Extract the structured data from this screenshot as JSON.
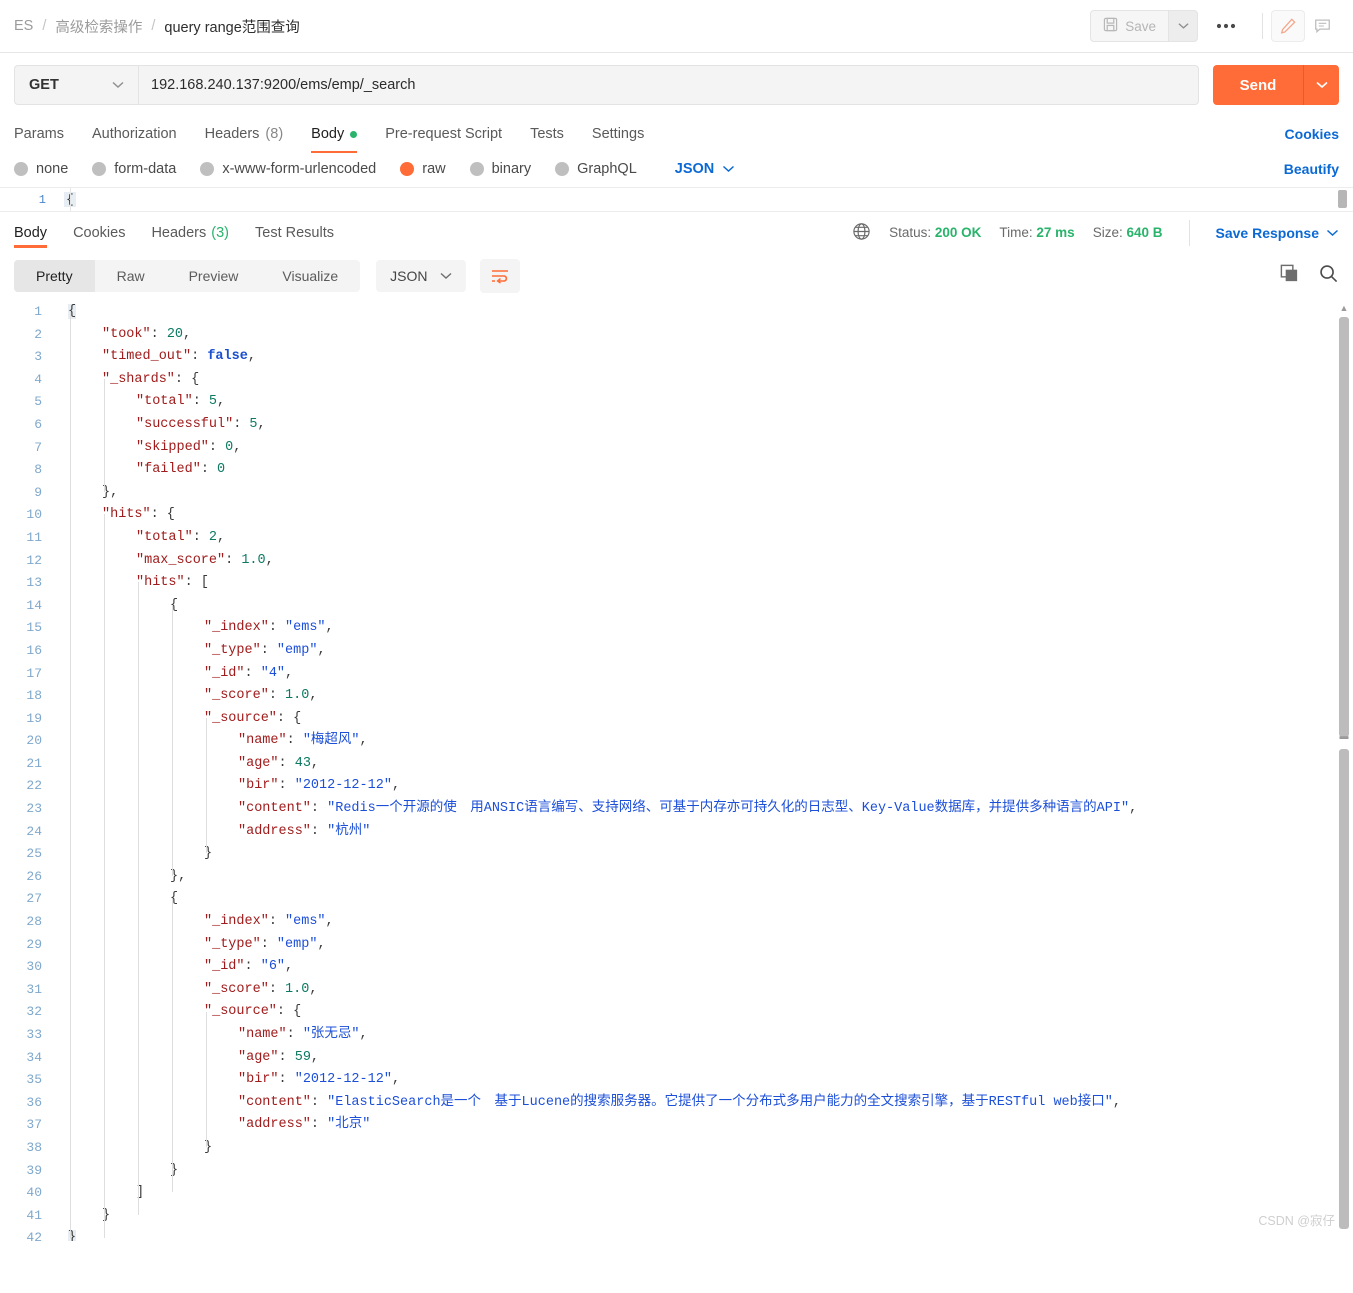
{
  "topbar": {
    "breadcrumb": [
      "ES",
      "高级检索操作",
      "query range范围查询"
    ],
    "separator": "/",
    "save_label": "Save",
    "more_label": "000",
    "caret": "∨"
  },
  "request": {
    "method": "GET",
    "method_caret": "∨",
    "url": "192.168.240.137:9200/ems/emp/_search",
    "send_label": "Send",
    "send_caret": "∨",
    "tabs": [
      {
        "label": "Params",
        "active": false
      },
      {
        "label": "Authorization",
        "active": false
      },
      {
        "label": "Headers",
        "count": "(8)",
        "active": false
      },
      {
        "label": "Body",
        "active": true,
        "dot": true
      },
      {
        "label": "Pre-request Script",
        "active": false
      },
      {
        "label": "Tests",
        "active": false
      },
      {
        "label": "Settings",
        "active": false
      }
    ],
    "cookies_label": "Cookies",
    "body_types": [
      {
        "label": "none",
        "selected": false
      },
      {
        "label": "form-data",
        "selected": false
      },
      {
        "label": "x-www-form-urlencoded",
        "selected": false
      },
      {
        "label": "raw",
        "selected": true
      },
      {
        "label": "binary",
        "selected": false
      },
      {
        "label": "GraphQL",
        "selected": false
      }
    ],
    "format": "JSON",
    "format_caret": "∨",
    "beautify_label": "Beautify",
    "editor_line_number": "1",
    "editor_text": "{"
  },
  "response": {
    "tabs": [
      {
        "label": "Body",
        "active": true
      },
      {
        "label": "Cookies",
        "active": false
      },
      {
        "label": "Headers",
        "count": "(3)",
        "active": false
      },
      {
        "label": "Test Results",
        "active": false
      }
    ],
    "status_label": "Status:",
    "status_value": "200 OK",
    "time_label": "Time:",
    "time_value": "27 ms",
    "size_label": "Size:",
    "size_value": "640 B",
    "save_response_label": "Save Response",
    "save_response_caret": "∨",
    "view_modes": [
      {
        "label": "Pretty",
        "active": true
      },
      {
        "label": "Raw",
        "active": false
      },
      {
        "label": "Preview",
        "active": false
      },
      {
        "label": "Visualize",
        "active": false
      }
    ],
    "format": "JSON",
    "format_caret": "∨",
    "lines": [
      {
        "no": "1",
        "indent": 0,
        "tokens": [
          {
            "t": "{",
            "c": "p",
            "hl": true
          }
        ]
      },
      {
        "no": "2",
        "indent": 1,
        "tokens": [
          {
            "t": "\"took\"",
            "c": "k"
          },
          {
            "t": ": ",
            "c": "p"
          },
          {
            "t": "20",
            "c": "n"
          },
          {
            "t": ",",
            "c": "p"
          }
        ]
      },
      {
        "no": "3",
        "indent": 1,
        "tokens": [
          {
            "t": "\"timed_out\"",
            "c": "k"
          },
          {
            "t": ": ",
            "c": "p"
          },
          {
            "t": "false",
            "c": "b"
          },
          {
            "t": ",",
            "c": "p"
          }
        ]
      },
      {
        "no": "4",
        "indent": 1,
        "tokens": [
          {
            "t": "\"_shards\"",
            "c": "k"
          },
          {
            "t": ": {",
            "c": "p"
          }
        ]
      },
      {
        "no": "5",
        "indent": 2,
        "tokens": [
          {
            "t": "\"total\"",
            "c": "k"
          },
          {
            "t": ": ",
            "c": "p"
          },
          {
            "t": "5",
            "c": "n"
          },
          {
            "t": ",",
            "c": "p"
          }
        ]
      },
      {
        "no": "6",
        "indent": 2,
        "tokens": [
          {
            "t": "\"successful\"",
            "c": "k"
          },
          {
            "t": ": ",
            "c": "p"
          },
          {
            "t": "5",
            "c": "n"
          },
          {
            "t": ",",
            "c": "p"
          }
        ]
      },
      {
        "no": "7",
        "indent": 2,
        "tokens": [
          {
            "t": "\"skipped\"",
            "c": "k"
          },
          {
            "t": ": ",
            "c": "p"
          },
          {
            "t": "0",
            "c": "n"
          },
          {
            "t": ",",
            "c": "p"
          }
        ]
      },
      {
        "no": "8",
        "indent": 2,
        "tokens": [
          {
            "t": "\"failed\"",
            "c": "k"
          },
          {
            "t": ": ",
            "c": "p"
          },
          {
            "t": "0",
            "c": "n"
          }
        ]
      },
      {
        "no": "9",
        "indent": 1,
        "tokens": [
          {
            "t": "},",
            "c": "p"
          }
        ]
      },
      {
        "no": "10",
        "indent": 1,
        "tokens": [
          {
            "t": "\"hits\"",
            "c": "k"
          },
          {
            "t": ": {",
            "c": "p"
          }
        ]
      },
      {
        "no": "11",
        "indent": 2,
        "tokens": [
          {
            "t": "\"total\"",
            "c": "k"
          },
          {
            "t": ": ",
            "c": "p"
          },
          {
            "t": "2",
            "c": "n"
          },
          {
            "t": ",",
            "c": "p"
          }
        ]
      },
      {
        "no": "12",
        "indent": 2,
        "tokens": [
          {
            "t": "\"max_score\"",
            "c": "k"
          },
          {
            "t": ": ",
            "c": "p"
          },
          {
            "t": "1.0",
            "c": "n"
          },
          {
            "t": ",",
            "c": "p"
          }
        ]
      },
      {
        "no": "13",
        "indent": 2,
        "tokens": [
          {
            "t": "\"hits\"",
            "c": "k"
          },
          {
            "t": ": [",
            "c": "p"
          }
        ]
      },
      {
        "no": "14",
        "indent": 3,
        "tokens": [
          {
            "t": "{",
            "c": "p"
          }
        ]
      },
      {
        "no": "15",
        "indent": 4,
        "tokens": [
          {
            "t": "\"_index\"",
            "c": "k"
          },
          {
            "t": ": ",
            "c": "p"
          },
          {
            "t": "\"ems\"",
            "c": "s"
          },
          {
            "t": ",",
            "c": "p"
          }
        ]
      },
      {
        "no": "16",
        "indent": 4,
        "tokens": [
          {
            "t": "\"_type\"",
            "c": "k"
          },
          {
            "t": ": ",
            "c": "p"
          },
          {
            "t": "\"emp\"",
            "c": "s"
          },
          {
            "t": ",",
            "c": "p"
          }
        ]
      },
      {
        "no": "17",
        "indent": 4,
        "tokens": [
          {
            "t": "\"_id\"",
            "c": "k"
          },
          {
            "t": ": ",
            "c": "p"
          },
          {
            "t": "\"4\"",
            "c": "s"
          },
          {
            "t": ",",
            "c": "p"
          }
        ]
      },
      {
        "no": "18",
        "indent": 4,
        "tokens": [
          {
            "t": "\"_score\"",
            "c": "k"
          },
          {
            "t": ": ",
            "c": "p"
          },
          {
            "t": "1.0",
            "c": "n"
          },
          {
            "t": ",",
            "c": "p"
          }
        ]
      },
      {
        "no": "19",
        "indent": 4,
        "tokens": [
          {
            "t": "\"_source\"",
            "c": "k"
          },
          {
            "t": ": {",
            "c": "p"
          }
        ]
      },
      {
        "no": "20",
        "indent": 5,
        "tokens": [
          {
            "t": "\"name\"",
            "c": "k"
          },
          {
            "t": ": ",
            "c": "p"
          },
          {
            "t": "\"梅超风\"",
            "c": "s"
          },
          {
            "t": ",",
            "c": "p"
          }
        ]
      },
      {
        "no": "21",
        "indent": 5,
        "tokens": [
          {
            "t": "\"age\"",
            "c": "k"
          },
          {
            "t": ": ",
            "c": "p"
          },
          {
            "t": "43",
            "c": "n"
          },
          {
            "t": ",",
            "c": "p"
          }
        ]
      },
      {
        "no": "22",
        "indent": 5,
        "tokens": [
          {
            "t": "\"bir\"",
            "c": "k"
          },
          {
            "t": ": ",
            "c": "p"
          },
          {
            "t": "\"2012-12-12\"",
            "c": "s"
          },
          {
            "t": ",",
            "c": "p"
          }
        ]
      },
      {
        "no": "23",
        "indent": 5,
        "tokens": [
          {
            "t": "\"content\"",
            "c": "k"
          },
          {
            "t": ": ",
            "c": "p"
          },
          {
            "t": "\"Redis一个开源的使　用ANSIC语言编写、支持网络、可基于内存亦可持久化的日志型、Key-Value数据库，并提供多种语言的API\"",
            "c": "s"
          },
          {
            "t": ",",
            "c": "p"
          }
        ]
      },
      {
        "no": "24",
        "indent": 5,
        "tokens": [
          {
            "t": "\"address\"",
            "c": "k"
          },
          {
            "t": ": ",
            "c": "p"
          },
          {
            "t": "\"杭州\"",
            "c": "s"
          }
        ]
      },
      {
        "no": "25",
        "indent": 4,
        "tokens": [
          {
            "t": "}",
            "c": "p"
          }
        ]
      },
      {
        "no": "26",
        "indent": 3,
        "tokens": [
          {
            "t": "},",
            "c": "p"
          }
        ]
      },
      {
        "no": "27",
        "indent": 3,
        "tokens": [
          {
            "t": "{",
            "c": "p"
          }
        ]
      },
      {
        "no": "28",
        "indent": 4,
        "tokens": [
          {
            "t": "\"_index\"",
            "c": "k"
          },
          {
            "t": ": ",
            "c": "p"
          },
          {
            "t": "\"ems\"",
            "c": "s"
          },
          {
            "t": ",",
            "c": "p"
          }
        ]
      },
      {
        "no": "29",
        "indent": 4,
        "tokens": [
          {
            "t": "\"_type\"",
            "c": "k"
          },
          {
            "t": ": ",
            "c": "p"
          },
          {
            "t": "\"emp\"",
            "c": "s"
          },
          {
            "t": ",",
            "c": "p"
          }
        ]
      },
      {
        "no": "30",
        "indent": 4,
        "tokens": [
          {
            "t": "\"_id\"",
            "c": "k"
          },
          {
            "t": ": ",
            "c": "p"
          },
          {
            "t": "\"6\"",
            "c": "s"
          },
          {
            "t": ",",
            "c": "p"
          }
        ]
      },
      {
        "no": "31",
        "indent": 4,
        "tokens": [
          {
            "t": "\"_score\"",
            "c": "k"
          },
          {
            "t": ": ",
            "c": "p"
          },
          {
            "t": "1.0",
            "c": "n"
          },
          {
            "t": ",",
            "c": "p"
          }
        ]
      },
      {
        "no": "32",
        "indent": 4,
        "tokens": [
          {
            "t": "\"_source\"",
            "c": "k"
          },
          {
            "t": ": {",
            "c": "p"
          }
        ]
      },
      {
        "no": "33",
        "indent": 5,
        "tokens": [
          {
            "t": "\"name\"",
            "c": "k"
          },
          {
            "t": ": ",
            "c": "p"
          },
          {
            "t": "\"张无忌\"",
            "c": "s"
          },
          {
            "t": ",",
            "c": "p"
          }
        ]
      },
      {
        "no": "34",
        "indent": 5,
        "tokens": [
          {
            "t": "\"age\"",
            "c": "k"
          },
          {
            "t": ": ",
            "c": "p"
          },
          {
            "t": "59",
            "c": "n"
          },
          {
            "t": ",",
            "c": "p"
          }
        ]
      },
      {
        "no": "35",
        "indent": 5,
        "tokens": [
          {
            "t": "\"bir\"",
            "c": "k"
          },
          {
            "t": ": ",
            "c": "p"
          },
          {
            "t": "\"2012-12-12\"",
            "c": "s"
          },
          {
            "t": ",",
            "c": "p"
          }
        ]
      },
      {
        "no": "36",
        "indent": 5,
        "tokens": [
          {
            "t": "\"content\"",
            "c": "k"
          },
          {
            "t": ": ",
            "c": "p"
          },
          {
            "t": "\"ElasticSearch是一个　基于Lucene的搜索服务器。它提供了一个分布式多用户能力的全文搜索引擎，基于RESTful web接口\"",
            "c": "s"
          },
          {
            "t": ",",
            "c": "p"
          }
        ]
      },
      {
        "no": "37",
        "indent": 5,
        "tokens": [
          {
            "t": "\"address\"",
            "c": "k"
          },
          {
            "t": ": ",
            "c": "p"
          },
          {
            "t": "\"北京\"",
            "c": "s"
          }
        ]
      },
      {
        "no": "38",
        "indent": 4,
        "tokens": [
          {
            "t": "}",
            "c": "p"
          }
        ]
      },
      {
        "no": "39",
        "indent": 3,
        "tokens": [
          {
            "t": "}",
            "c": "p"
          }
        ]
      },
      {
        "no": "40",
        "indent": 2,
        "tokens": [
          {
            "t": "]",
            "c": "p"
          }
        ]
      },
      {
        "no": "41",
        "indent": 1,
        "tokens": [
          {
            "t": "}",
            "c": "p"
          }
        ]
      },
      {
        "no": "42",
        "indent": 0,
        "tokens": [
          {
            "t": "}",
            "c": "p",
            "hl": true
          }
        ]
      }
    ]
  },
  "watermark": "CSDN @寂仔",
  "colors": {
    "accent": "#ff6c37",
    "link": "#0b69d4",
    "success": "#29b36b",
    "json_key": "#a01b1b",
    "json_string": "#1c4fd8",
    "json_number": "#0c7a63",
    "json_bool": "#1a4fd0"
  }
}
